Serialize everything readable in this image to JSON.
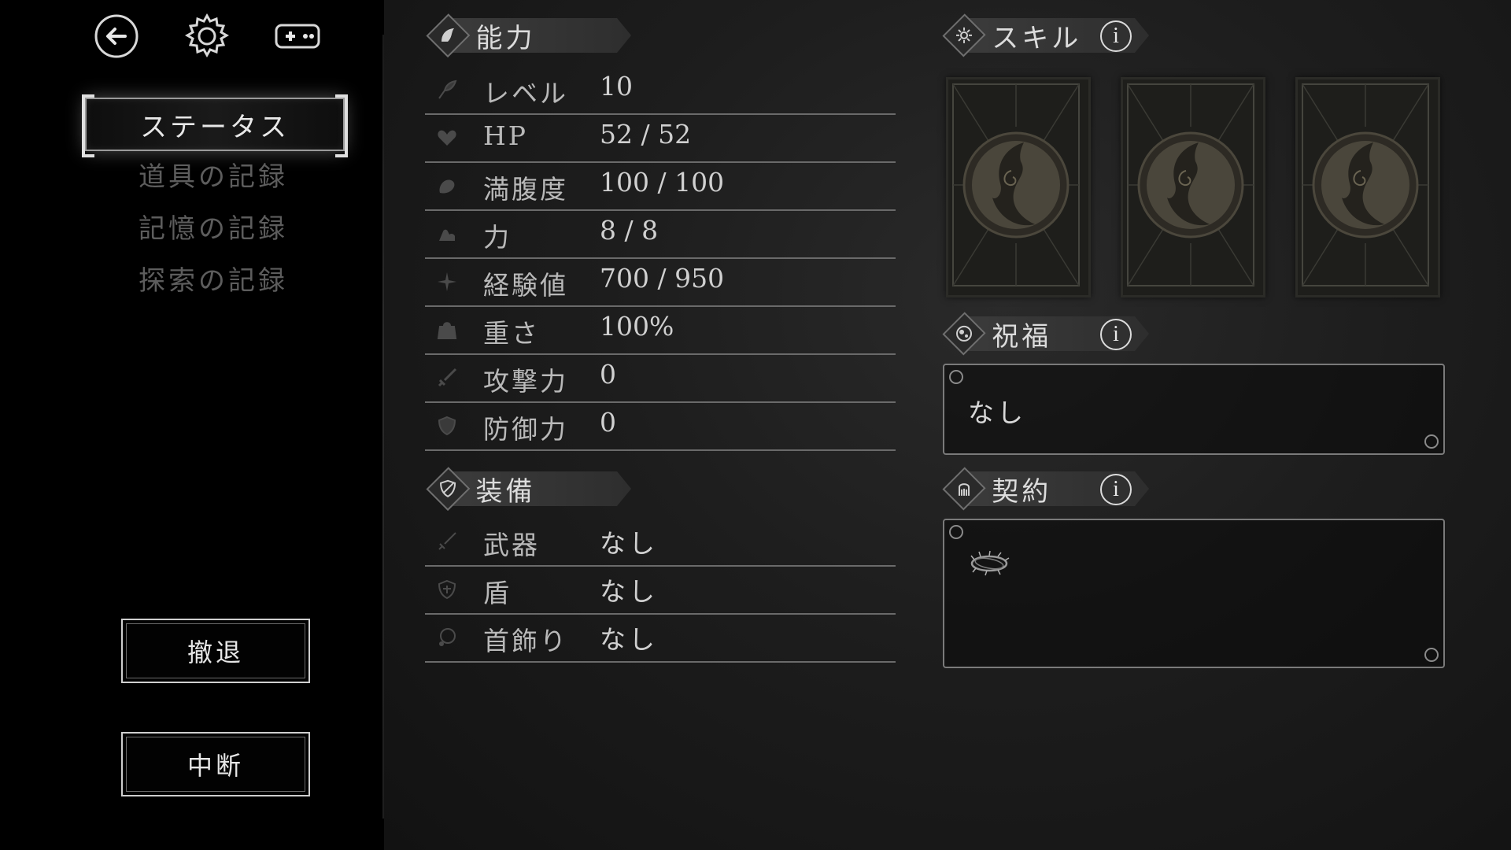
{
  "sidebar": {
    "top_icons": [
      "back-arrow-icon",
      "settings-gear-icon",
      "gamepad-icon"
    ],
    "nav": [
      {
        "label": "ステータス",
        "active": true
      },
      {
        "label": "道具の記録",
        "active": false
      },
      {
        "label": "記憶の記録",
        "active": false
      },
      {
        "label": "探索の記録",
        "active": false
      }
    ],
    "retreat_label": "撤退",
    "suspend_label": "中断"
  },
  "ability": {
    "title": "能力",
    "rows": [
      {
        "icon": "feather-icon",
        "label": "レベル",
        "value": "10"
      },
      {
        "icon": "heart-icon",
        "label": "HP",
        "value": "52 / 52"
      },
      {
        "icon": "meat-icon",
        "label": "満腹度",
        "value": "100 / 100"
      },
      {
        "icon": "arm-icon",
        "label": "力",
        "value": "8 / 8"
      },
      {
        "icon": "star-icon",
        "label": "経験値",
        "value": "700 / 950"
      },
      {
        "icon": "bag-icon",
        "label": "重さ",
        "value": "100%"
      },
      {
        "icon": "sword-icon",
        "label": "攻撃力",
        "value": "0"
      },
      {
        "icon": "shield-icon",
        "label": "防御力",
        "value": "0"
      }
    ]
  },
  "equipment": {
    "title": "装備",
    "rows": [
      {
        "icon": "weapon-icon",
        "label": "武器",
        "value": "なし"
      },
      {
        "icon": "shield-cross-icon",
        "label": "盾",
        "value": "なし"
      },
      {
        "icon": "necklace-icon",
        "label": "首飾り",
        "value": "なし"
      }
    ]
  },
  "skill": {
    "title": "スキル",
    "info": "i",
    "cards": 3
  },
  "blessing": {
    "title": "祝福",
    "info": "i",
    "text": "なし"
  },
  "contract": {
    "title": "契約",
    "info": "i"
  }
}
